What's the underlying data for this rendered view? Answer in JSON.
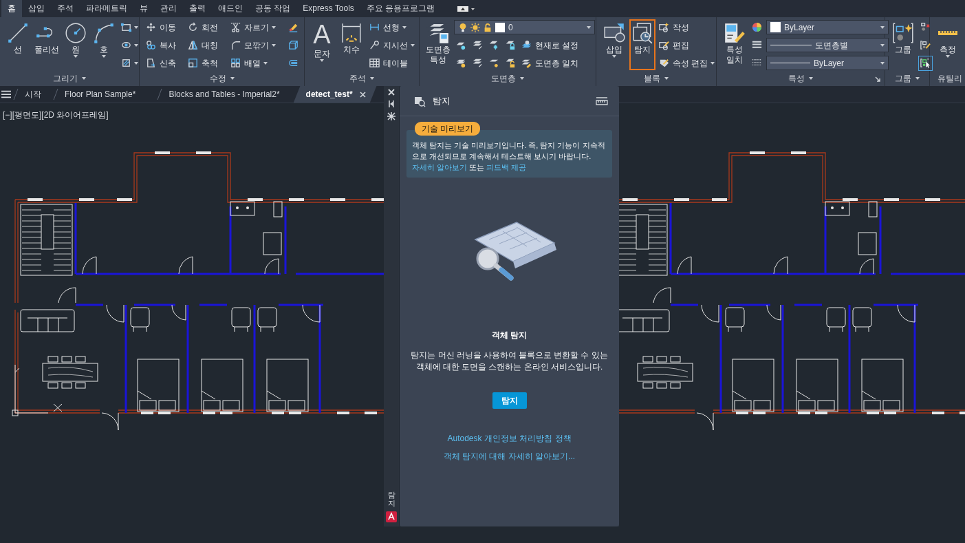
{
  "menu_tabs": [
    {
      "label": "홈",
      "selected": true
    },
    {
      "label": "삽입",
      "selected": false
    },
    {
      "label": "주석",
      "selected": false
    },
    {
      "label": "파라메트릭",
      "selected": false
    },
    {
      "label": "뷰",
      "selected": false
    },
    {
      "label": "관리",
      "selected": false
    },
    {
      "label": "출력",
      "selected": false
    },
    {
      "label": "애드인",
      "selected": false
    },
    {
      "label": "공동 작업",
      "selected": false
    },
    {
      "label": "Express Tools",
      "selected": false
    },
    {
      "label": "주요 응용프로그램",
      "selected": false
    }
  ],
  "ribbon": {
    "panels": [
      {
        "title": "그리기",
        "columns": [
          [
            [
              {
                "kind": "large",
                "label": "선"
              }
            ]
          ],
          [
            [
              {
                "kind": "large",
                "label": "폴리선"
              }
            ]
          ],
          [
            [
              {
                "kind": "large",
                "label": "원",
                "dropdown": true
              }
            ]
          ],
          [
            [
              {
                "kind": "large",
                "label": "호",
                "dropdown": true
              }
            ]
          ],
          [
            [
              {
                "kind": "icon",
                "dropdown": true
              }
            ],
            [
              {
                "kind": "icon",
                "dropdown": true
              }
            ],
            [
              {
                "kind": "icon",
                "dropdown": true
              }
            ]
          ]
        ]
      },
      {
        "title": "수정",
        "columns": [
          [
            [
              {
                "kind": "small",
                "label": "이동"
              }
            ],
            [
              {
                "kind": "small",
                "label": "복사"
              }
            ],
            [
              {
                "kind": "small",
                "label": "신축"
              }
            ]
          ],
          [
            [
              {
                "kind": "small",
                "label": "회전"
              }
            ],
            [
              {
                "kind": "small",
                "label": "대칭"
              }
            ],
            [
              {
                "kind": "small",
                "label": "축척"
              }
            ]
          ],
          [
            [
              {
                "kind": "small",
                "label": "자르기",
                "dropdown": true
              }
            ],
            [
              {
                "kind": "small",
                "label": "모깎기",
                "dropdown": true
              }
            ],
            [
              {
                "kind": "small",
                "label": "배열",
                "dropdown": true
              }
            ]
          ],
          [
            [
              {
                "kind": "icon"
              }
            ],
            [
              {
                "kind": "icon"
              }
            ],
            [
              {
                "kind": "icon"
              }
            ]
          ]
        ]
      },
      {
        "title": "주석",
        "columns": [
          [
            [
              {
                "kind": "large",
                "label": "문자",
                "glyph": "A",
                "dropdown": true
              }
            ]
          ],
          [
            [
              {
                "kind": "large",
                "label": "치수"
              }
            ]
          ],
          [
            [
              {
                "kind": "small",
                "label": "선형",
                "dropdown": true
              }
            ],
            [
              {
                "kind": "small",
                "label": "지시선",
                "dropdown": true
              }
            ],
            [
              {
                "kind": "small",
                "label": "테이블"
              }
            ]
          ]
        ]
      },
      {
        "title": "도면층",
        "columns": [
          [
            [
              {
                "kind": "large",
                "label": "도면층 특성"
              }
            ]
          ],
          [
            [
              {
                "kind": "layer-combo",
                "value": "0"
              }
            ],
            [
              {
                "kind": "icon"
              },
              {
                "kind": "icon"
              },
              {
                "kind": "icon"
              },
              {
                "kind": "icon"
              },
              {
                "kind": "small",
                "label": "현재로 설정"
              }
            ],
            [
              {
                "kind": "icon"
              },
              {
                "kind": "icon"
              },
              {
                "kind": "icon"
              },
              {
                "kind": "icon"
              },
              {
                "kind": "small",
                "label": "도면층 일치"
              }
            ]
          ]
        ]
      },
      {
        "title": "블록",
        "columns": [
          [
            [
              {
                "kind": "large",
                "label": "삽입",
                "dropdown": true,
                "highlighted": false
              }
            ]
          ],
          [
            [
              {
                "kind": "large",
                "label": "탐지",
                "highlighted": true
              }
            ]
          ],
          [
            [
              {
                "kind": "small",
                "label": "작성"
              }
            ],
            [
              {
                "kind": "small",
                "label": "편집"
              }
            ],
            [
              {
                "kind": "small",
                "label": "속성 편집",
                "dropdown": true
              }
            ]
          ]
        ]
      },
      {
        "title": "특성",
        "launcher": true,
        "columns": [
          [
            [
              {
                "kind": "large",
                "label": "특성 일치"
              }
            ]
          ],
          [
            [
              {
                "kind": "icon"
              },
              {
                "kind": "color-combo",
                "value": "ByLayer"
              }
            ],
            [
              {
                "kind": "icon"
              },
              {
                "kind": "line-combo",
                "value": "도면층별"
              }
            ],
            [
              {
                "kind": "icon"
              },
              {
                "kind": "line-combo",
                "value": "ByLayer"
              }
            ]
          ]
        ]
      },
      {
        "title": "그룹",
        "columns": [
          [
            [
              {
                "kind": "large",
                "label": "그룹"
              }
            ]
          ],
          [
            [
              {
                "kind": "icon",
                "on": false
              }
            ],
            [
              {
                "kind": "icon",
                "on": false
              }
            ],
            [
              {
                "kind": "icon",
                "on": true
              }
            ]
          ]
        ]
      },
      {
        "title": "유틸리",
        "columns": [
          [
            [
              {
                "kind": "large",
                "label": "측정",
                "dropdown": true
              }
            ]
          ]
        ]
      }
    ]
  },
  "doc_tabs": [
    {
      "label": "시작",
      "selected": false
    },
    {
      "label": "Floor Plan Sample*",
      "selected": false
    },
    {
      "label": "Blocks and Tables - Imperial2*",
      "selected": false
    },
    {
      "label": "detect_test*",
      "selected": true
    }
  ],
  "viewport_controls": [
    "[−]",
    "[평면도]",
    "[2D 와이어프레임]"
  ],
  "palette": {
    "strip_label": "탐지",
    "title": "탐지",
    "badge": "기술 미리보기",
    "notice": {
      "text": "객체 탐지는 기술 미리보기입니다. 즉, 탐지 기능이 지속적으로 개선되므로 계속해서 테스트해 보시기 바랍니다.",
      "links": [
        {
          "kind": "link",
          "text": "자세히 알아보기"
        },
        {
          "kind": "text",
          "text": "또는"
        },
        {
          "kind": "link",
          "text": "피드백 제공"
        }
      ]
    },
    "heading": "객체 탐지",
    "description": "탐지는 머신 러닝을 사용하여 블록으로 변환할 수 있는 객체에 대한 도면을 스캔하는 온라인 서비스입니다.",
    "button": "탐지",
    "links": [
      "Autodesk 개인정보 처리방침 정책",
      "객체 탐지에 대해 자세히 알아보기..."
    ]
  }
}
